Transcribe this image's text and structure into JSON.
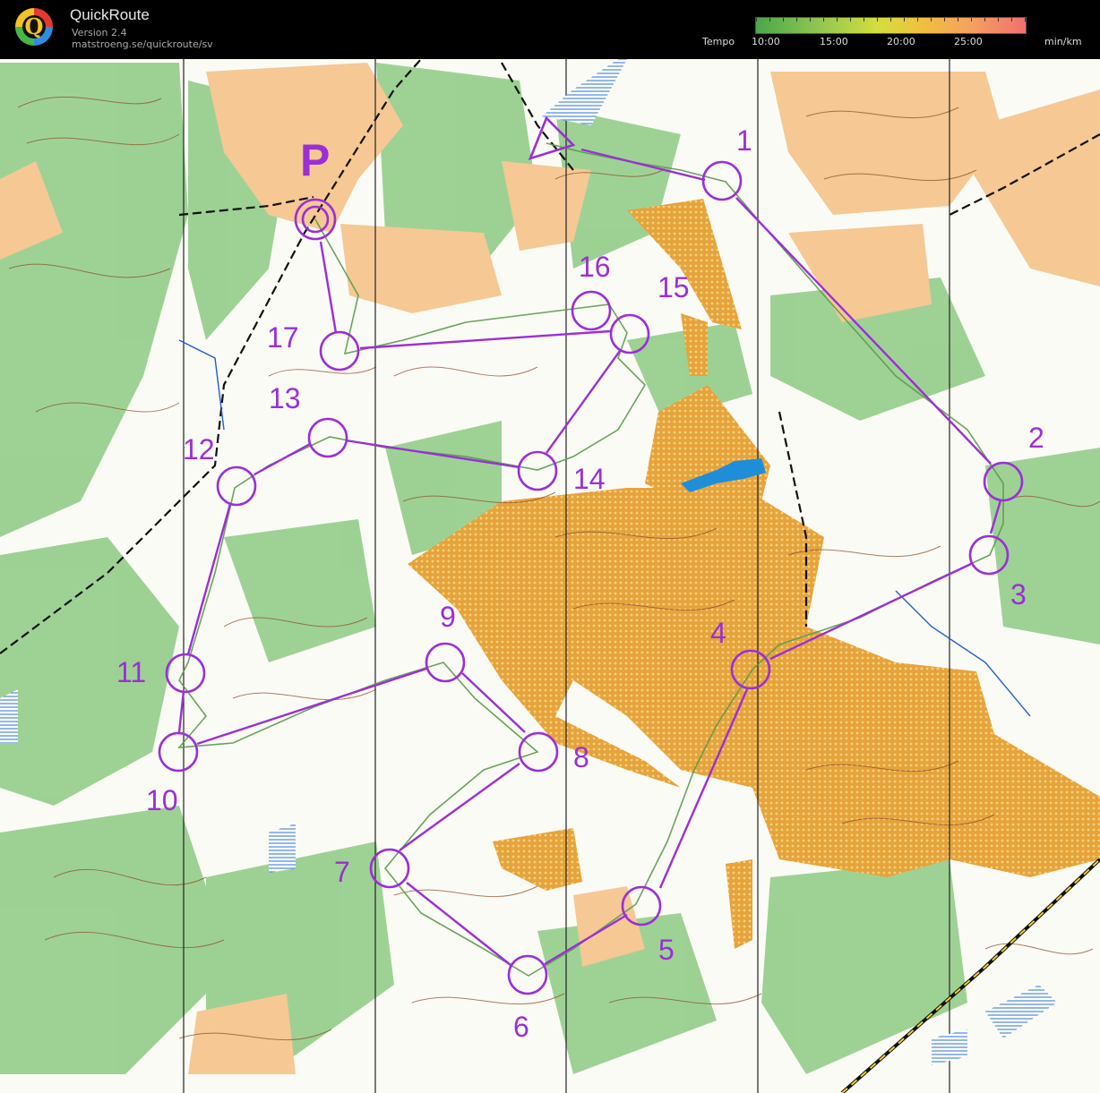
{
  "app": {
    "title": "QuickRoute",
    "version": "Version 2.4",
    "url": "matstroeng.se/quickroute/sv",
    "logo_letter": "Q"
  },
  "tempo": {
    "label": "Tempo",
    "ticks": [
      "10:00",
      "15:00",
      "20:00",
      "25:00"
    ],
    "unit": "min/km"
  },
  "map": {
    "start_label": "P",
    "controls": [
      {
        "label": "1"
      },
      {
        "label": "2"
      },
      {
        "label": "3"
      },
      {
        "label": "4"
      },
      {
        "label": "5"
      },
      {
        "label": "6"
      },
      {
        "label": "7"
      },
      {
        "label": "8"
      },
      {
        "label": "9"
      },
      {
        "label": "10"
      },
      {
        "label": "11"
      },
      {
        "label": "12"
      },
      {
        "label": "13"
      },
      {
        "label": "14"
      },
      {
        "label": "15"
      },
      {
        "label": "16"
      },
      {
        "label": "17"
      }
    ],
    "colors": {
      "course": "#9b2fd6",
      "forest_green": "#7cc276",
      "open_land": "#f5c894",
      "rough_open": "#e6a33c",
      "contour": "#8a4a22",
      "water": "#1f8ed9"
    }
  }
}
